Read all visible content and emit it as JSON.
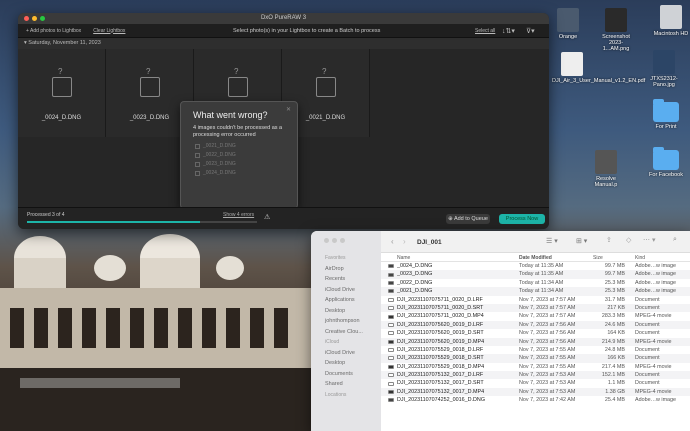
{
  "desktop": {
    "icons": [
      {
        "label": "Orange",
        "color": "#4a5a6e",
        "kind": "thumb"
      },
      {
        "label": "Screenshot 2023-1...AM.png",
        "color": "#2a2a2a",
        "kind": "thumb"
      },
      {
        "label": "Macintosh HD",
        "color": "#cfd2d6",
        "kind": "thumb"
      },
      {
        "label": "JTXS2312-Pano.jpg",
        "color": "#2c4566",
        "kind": "thumb"
      },
      {
        "label": "DJI_Air_3_User_Manual_v1.2_EN.pdf",
        "color": "#eeeeee",
        "kind": "thumb"
      },
      {
        "label": "For Print",
        "kind": "folder"
      },
      {
        "label": "Resolve Manual.p",
        "color": "#555",
        "kind": "thumb"
      },
      {
        "label": "For Facebook",
        "kind": "folder"
      }
    ]
  },
  "dxo": {
    "title": "DxO PureRAW 3",
    "add_photos": "+ Add photos to Lightbox",
    "clear": "Clear Lightbox",
    "instruction": "Select photo(s) in your Lightbox to create a Batch to process",
    "select_all": "Select all",
    "date_header": "Saturday, November 11, 2023",
    "cells": [
      {
        "q": "?",
        "name": "_0024_D.DNG"
      },
      {
        "q": "?",
        "name": "_0023_D.DNG"
      },
      {
        "q": "?",
        "name": ""
      },
      {
        "q": "?",
        "name": "_0021_D.DNG"
      }
    ],
    "popup": {
      "title": "What went wrong?",
      "message": "4 images couldn't be processed as a processing error occurred",
      "errors": [
        "_0021_D.DNG",
        "_0022_D.DNG",
        "_0023_D.DNG",
        "_0024_D.DNG"
      ]
    },
    "processed": "Processed 3 of 4",
    "errors_link": "Show 4 errors",
    "progress": 0.75,
    "add_queue": "Add to Queue",
    "process_now": "Process Now",
    "accent": "#1db4a8"
  },
  "finder": {
    "folder": "DJI_001",
    "sidebar": [
      {
        "label": "Favorites",
        "hdr": true
      },
      {
        "label": "AirDrop"
      },
      {
        "label": "Recents"
      },
      {
        "label": "iCloud Drive"
      },
      {
        "label": "Applications"
      },
      {
        "label": "Desktop"
      },
      {
        "label": "johnthompson"
      },
      {
        "label": "Creative Clou..."
      },
      {
        "label": "iCloud",
        "hdr": true
      },
      {
        "label": "iCloud Drive"
      },
      {
        "label": "Desktop"
      },
      {
        "label": "Documents"
      },
      {
        "label": "Shared"
      },
      {
        "label": "Locations",
        "hdr": true
      }
    ],
    "columns": [
      "Name",
      "Date Modified",
      "Size",
      "Kind"
    ],
    "rows": [
      {
        "n": "_0024_D.DNG",
        "d": "Today at 11:35 AM",
        "s": "99.7 MB",
        "k": "Adobe…w image",
        "c": "#444"
      },
      {
        "n": "_0023_D.DNG",
        "d": "Today at 11:35 AM",
        "s": "99.7 MB",
        "k": "Adobe…w image",
        "c": "#444"
      },
      {
        "n": "_0022_D.DNG",
        "d": "Today at 11:34 AM",
        "s": "25.3 MB",
        "k": "Adobe…w image",
        "c": "#444"
      },
      {
        "n": "_0021_D.DNG",
        "d": "Today at 11:34 AM",
        "s": "25.3 MB",
        "k": "Adobe…w image",
        "c": "#444"
      },
      {
        "n": "DJI_20231107075711_0020_D.LRF",
        "d": "Nov 7, 2023 at 7:57 AM",
        "s": "31.7 MB",
        "k": "Document",
        "c": "#fff"
      },
      {
        "n": "DJI_20231107075711_0020_D.SRT",
        "d": "Nov 7, 2023 at 7:57 AM",
        "s": "217 KB",
        "k": "Document",
        "c": "#fff"
      },
      {
        "n": "DJI_20231107075711_0020_D.MP4",
        "d": "Nov 7, 2023 at 7:57 AM",
        "s": "283.3 MB",
        "k": "MPEG-4 movie",
        "c": "#333"
      },
      {
        "n": "DJI_20231107075620_0019_D.LRF",
        "d": "Nov 7, 2023 at 7:56 AM",
        "s": "24.6 MB",
        "k": "Document",
        "c": "#fff"
      },
      {
        "n": "DJI_20231107075620_0019_D.SRT",
        "d": "Nov 7, 2023 at 7:56 AM",
        "s": "164 KB",
        "k": "Document",
        "c": "#fff"
      },
      {
        "n": "DJI_20231107075620_0019_D.MP4",
        "d": "Nov 7, 2023 at 7:56 AM",
        "s": "214.9 MB",
        "k": "MPEG-4 movie",
        "c": "#333"
      },
      {
        "n": "DJI_20231107075529_0018_D.LRF",
        "d": "Nov 7, 2023 at 7:55 AM",
        "s": "24.8 MB",
        "k": "Document",
        "c": "#fff"
      },
      {
        "n": "DJI_20231107075529_0018_D.SRT",
        "d": "Nov 7, 2023 at 7:55 AM",
        "s": "166 KB",
        "k": "Document",
        "c": "#fff"
      },
      {
        "n": "DJI_20231107075529_0018_D.MP4",
        "d": "Nov 7, 2023 at 7:55 AM",
        "s": "217.4 MB",
        "k": "MPEG-4 movie",
        "c": "#333"
      },
      {
        "n": "DJI_20231107075132_0017_D.LRF",
        "d": "Nov 7, 2023 at 7:53 AM",
        "s": "152.1 MB",
        "k": "Document",
        "c": "#fff"
      },
      {
        "n": "DJI_20231107075132_0017_D.SRT",
        "d": "Nov 7, 2023 at 7:53 AM",
        "s": "1.1 MB",
        "k": "Document",
        "c": "#fff"
      },
      {
        "n": "DJI_20231107075132_0017_D.MP4",
        "d": "Nov 7, 2023 at 7:53 AM",
        "s": "1.38 GB",
        "k": "MPEG-4 movie",
        "c": "#333"
      },
      {
        "n": "DJI_20231107074252_0016_D.DNG",
        "d": "Nov 7, 2023 at 7:42 AM",
        "s": "25.4 MB",
        "k": "Adobe…w image",
        "c": "#444"
      }
    ]
  }
}
